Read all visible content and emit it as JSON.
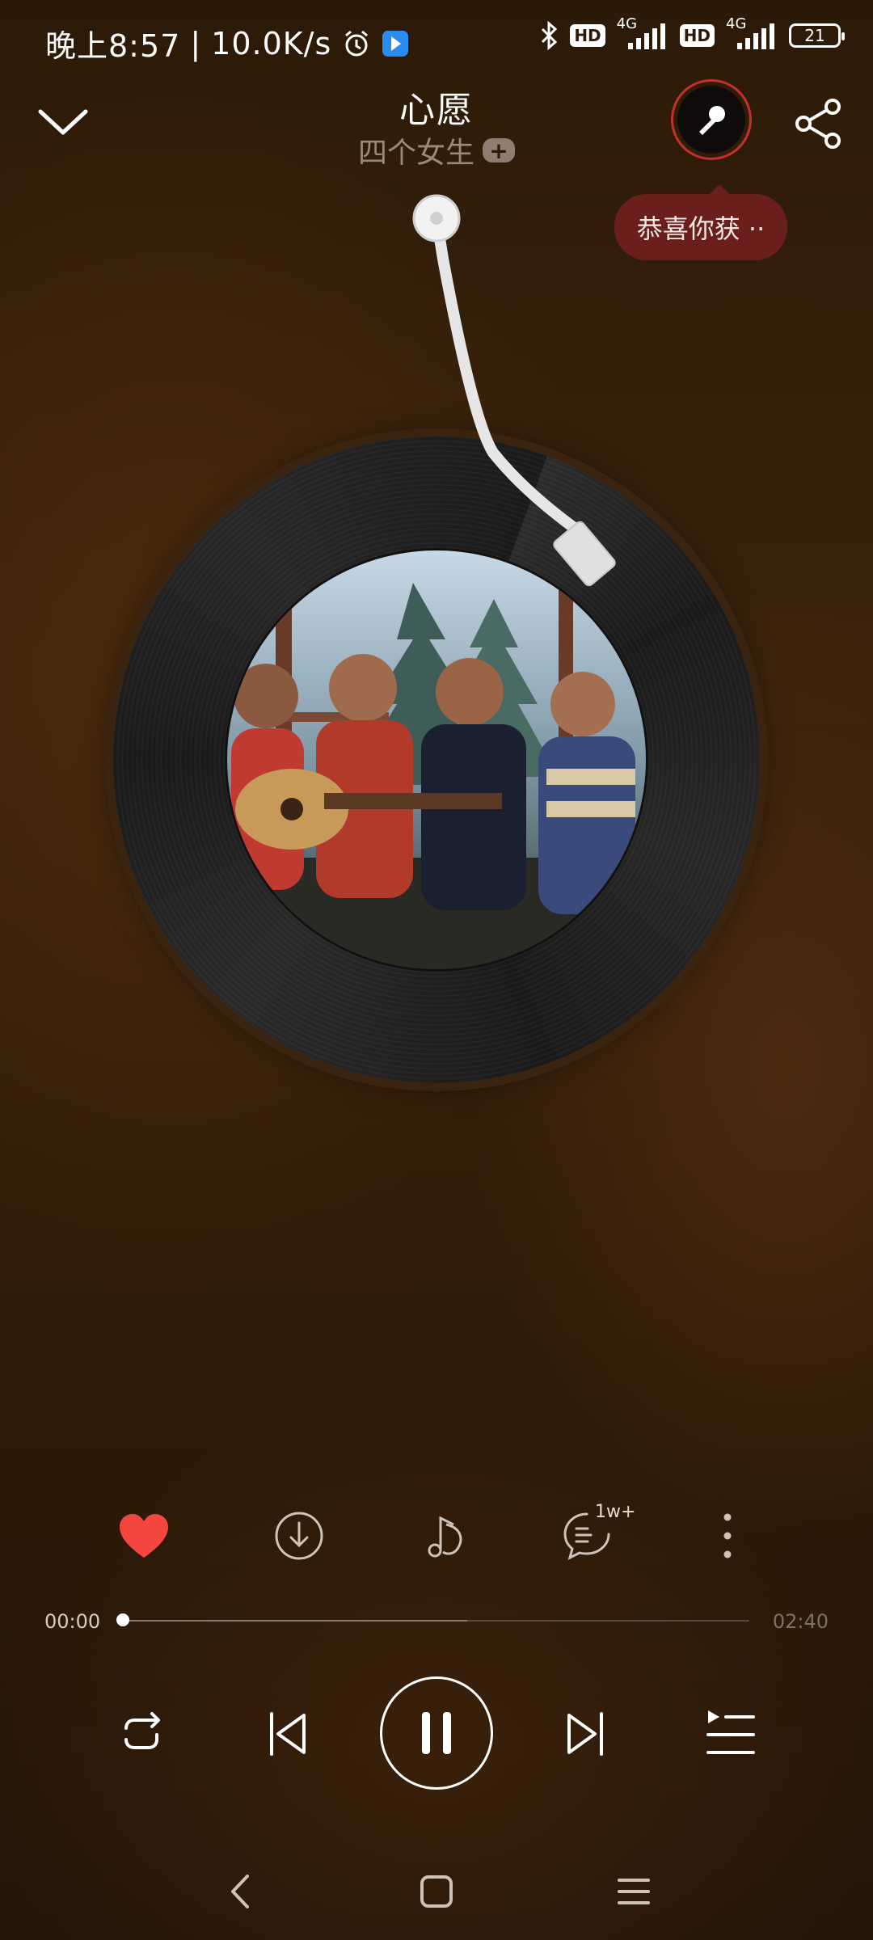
{
  "status_bar": {
    "time": "晚上8:57",
    "speed": "10.0K/s",
    "bluetooth_icon": "bluetooth-icon",
    "hd1": "HD",
    "net1": "4G",
    "hd2": "HD",
    "net2": "4G",
    "battery": "21"
  },
  "song": {
    "title": "心愿",
    "artist": "四个女生",
    "follow_symbol": "+"
  },
  "tooltip": {
    "text": "恭喜你获 ··"
  },
  "actions": {
    "comments_badge": "1w+"
  },
  "progress": {
    "current": "00:00",
    "total": "02:40",
    "played_fraction": 0.0,
    "buffered_fraction": 0.55
  },
  "colors": {
    "like": "#f2463f",
    "accent_ring": "#c2312d",
    "tooltip_bg": "#6a1f1c"
  }
}
